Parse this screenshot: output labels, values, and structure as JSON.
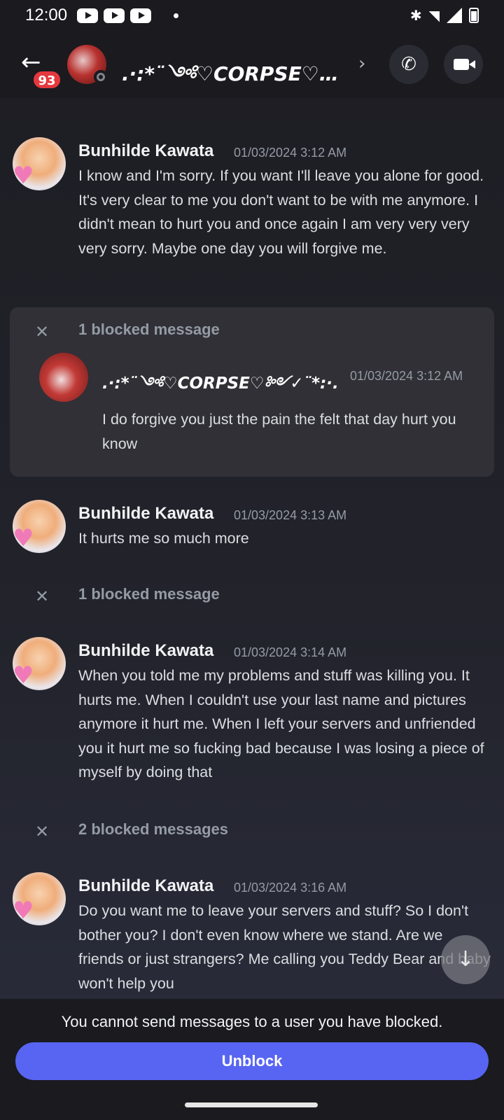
{
  "status_bar": {
    "time": "12:00"
  },
  "header": {
    "unread_badge": "93",
    "title": ".·:*¨༺♡CORPSE♡…"
  },
  "messages": [
    {
      "author": "Bunhilde Kawata",
      "timestamp": "01/03/2024 3:12 AM",
      "text": "I know and I'm sorry. If you want I'll leave you alone for good. It's very clear to me you don't want to be with me anymore. I didn't mean to hurt you and once again I am very very very very sorry. Maybe one day you will forgive me."
    },
    {
      "author": "Bunhilde Kawata",
      "timestamp": "01/03/2024 3:13 AM",
      "text": "It hurts me so much more"
    },
    {
      "author": "Bunhilde Kawata",
      "timestamp": "01/03/2024 3:14 AM",
      "text": "When you told me my problems and stuff was killing you. It hurts me. When I couldn't use your last name and pictures anymore it hurt me. When I left your servers and unfriended you it hurt me so fucking bad because I was losing a piece of myself by doing that"
    },
    {
      "author": "Bunhilde Kawata",
      "timestamp": "01/03/2024 3:16 AM",
      "text": "Do you want me to leave your servers and stuff? So I don't bother you? I don't even know where we stand. Are we friends or just strangers? Me calling you Teddy Bear and baby won't help you"
    }
  ],
  "blocked": [
    {
      "label": "1 blocked message"
    },
    {
      "label": "1 blocked message"
    },
    {
      "label": "2 blocked messages"
    }
  ],
  "revealed_blocked": {
    "author": ".·:*¨༺♡CORPSE♡༻✓¨*:·.",
    "timestamp": "01/03/2024 3:12 AM",
    "text": "I do forgive you just the pain the felt that day hurt you know"
  },
  "footer": {
    "note": "You cannot send messages to a user you have blocked.",
    "unblock_label": "Unblock"
  }
}
